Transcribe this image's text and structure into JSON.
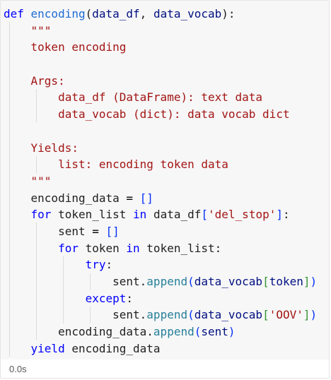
{
  "cell": {
    "execution_time": "0.0s",
    "lines": [
      [
        [
          "kw",
          "def "
        ],
        [
          "fnblue",
          "encoding"
        ],
        [
          "txt",
          "("
        ],
        [
          "param",
          "data_df"
        ],
        [
          "txt",
          ", "
        ],
        [
          "param",
          "data_vocab"
        ],
        [
          "txt",
          "):"
        ]
      ],
      [
        [
          "txt",
          "    "
        ],
        [
          "doc",
          "\"\"\""
        ]
      ],
      [
        [
          "txt",
          "    "
        ],
        [
          "doc",
          "token encoding"
        ]
      ],
      [
        [
          "txt",
          ""
        ]
      ],
      [
        [
          "txt",
          "    "
        ],
        [
          "doc",
          "Args:"
        ]
      ],
      [
        [
          "txt",
          "        "
        ],
        [
          "doc",
          "data_df (DataFrame): text data"
        ]
      ],
      [
        [
          "txt",
          "        "
        ],
        [
          "doc",
          "data_vocab (dict): data vocab dict"
        ]
      ],
      [
        [
          "txt",
          ""
        ]
      ],
      [
        [
          "txt",
          "    "
        ],
        [
          "doc",
          "Yields:"
        ]
      ],
      [
        [
          "txt",
          "        "
        ],
        [
          "doc",
          "list: encoding token data"
        ]
      ],
      [
        [
          "txt",
          "    "
        ],
        [
          "doc",
          "\"\"\""
        ]
      ],
      [
        [
          "txt",
          "    encoding_data "
        ],
        [
          "op",
          "= "
        ],
        [
          "bracket-blue",
          "[]"
        ]
      ],
      [
        [
          "txt",
          "    "
        ],
        [
          "kw",
          "for "
        ],
        [
          "txt",
          "token_list "
        ],
        [
          "kw",
          "in "
        ],
        [
          "txt",
          "data_df"
        ],
        [
          "bracket-blue",
          "["
        ],
        [
          "str",
          "'del_stop'"
        ],
        [
          "bracket-blue",
          "]"
        ],
        [
          "txt",
          ":"
        ]
      ],
      [
        [
          "txt",
          "        sent "
        ],
        [
          "op",
          "= "
        ],
        [
          "bracket-blue",
          "[]"
        ]
      ],
      [
        [
          "txt",
          "        "
        ],
        [
          "kw",
          "for "
        ],
        [
          "txt",
          "token "
        ],
        [
          "kw",
          "in "
        ],
        [
          "txt",
          "token_list:"
        ]
      ],
      [
        [
          "txt",
          "            "
        ],
        [
          "kw",
          "try"
        ],
        [
          "txt",
          ":"
        ]
      ],
      [
        [
          "txt",
          "                sent."
        ],
        [
          "method",
          "append"
        ],
        [
          "bracket-blue",
          "("
        ],
        [
          "param",
          "data_vocab"
        ],
        [
          "bracket-teal",
          "["
        ],
        [
          "param",
          "token"
        ],
        [
          "bracket-teal",
          "]"
        ],
        [
          "bracket-blue",
          ")"
        ]
      ],
      [
        [
          "txt",
          "            "
        ],
        [
          "kw",
          "except"
        ],
        [
          "txt",
          ":"
        ]
      ],
      [
        [
          "txt",
          "                sent."
        ],
        [
          "method",
          "append"
        ],
        [
          "bracket-blue",
          "("
        ],
        [
          "param",
          "data_vocab"
        ],
        [
          "bracket-teal",
          "["
        ],
        [
          "str",
          "'OOV'"
        ],
        [
          "bracket-teal",
          "]"
        ],
        [
          "bracket-blue",
          ")"
        ]
      ],
      [
        [
          "txt",
          "        encoding_data."
        ],
        [
          "method",
          "append"
        ],
        [
          "bracket-blue",
          "("
        ],
        [
          "param",
          "sent"
        ],
        [
          "bracket-blue",
          ")"
        ]
      ],
      [
        [
          "txt",
          "    "
        ],
        [
          "kw",
          "yield "
        ],
        [
          "txt",
          "encoding_data"
        ]
      ]
    ]
  }
}
